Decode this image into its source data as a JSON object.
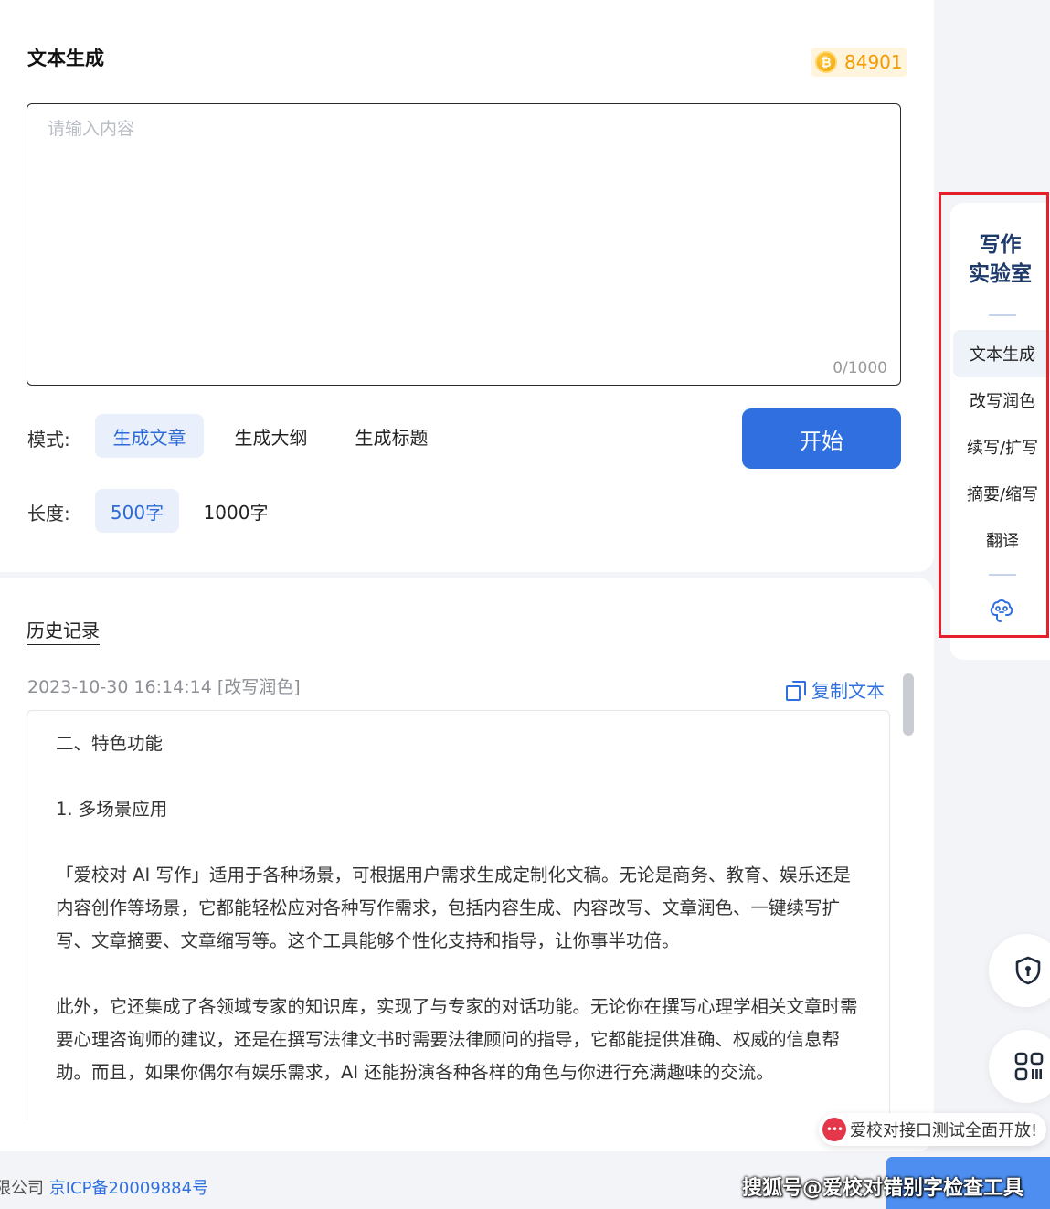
{
  "generator": {
    "title": "文本生成",
    "coins": "84901",
    "coin_symbol": "₿",
    "input_placeholder": "请输入内容",
    "input_value": "",
    "counter": "0/1000",
    "mode_label": "模式:",
    "modes": [
      {
        "label": "生成文章",
        "active": true
      },
      {
        "label": "生成大纲",
        "active": false
      },
      {
        "label": "生成标题",
        "active": false
      }
    ],
    "length_label": "长度:",
    "lengths": [
      {
        "label": "500字",
        "active": true
      },
      {
        "label": "1000字",
        "active": false
      }
    ],
    "start_label": "开始"
  },
  "history": {
    "title": "历史记录",
    "entry_time": "2023-10-30 16:14:14 [改写润色]",
    "copy_label": "复制文本",
    "paragraphs": [
      "二、特色功能",
      "1. 多场景应用",
      "「爱校对 AI 写作」适用于各种场景，可根据用户需求生成定制化文稿。无论是商务、教育、娱乐还是内容创作等场景，它都能轻松应对各种写作需求，包括内容生成、内容改写、文章润色、一键续写扩写、文章摘要、文章缩写等。这个工具能够个性化支持和指导，让你事半功倍。",
      "此外，它还集成了各领域专家的知识库，实现了与专家的对话功能。无论你在撰写心理学相关文章时需要心理咨询师的建议，还是在撰写法律文书时需要法律顾问的指导，它都能提供准确、权威的信息帮助。而且，如果你偶尔有娱乐需求，AI 还能扮演各种各样的角色与你进行充满趣味的交流。"
    ]
  },
  "sidebar": {
    "title_line1": "写作",
    "title_line2": "实验室",
    "items": [
      {
        "label": "文本生成",
        "active": true
      },
      {
        "label": "改写润色",
        "active": false
      },
      {
        "label": "续写/扩写",
        "active": false
      },
      {
        "label": "摘要/缩写",
        "active": false
      },
      {
        "label": "翻译",
        "active": false
      }
    ]
  },
  "toast": {
    "icon_text": "•••",
    "text": "爱校对接口测试全面开放!"
  },
  "footer": {
    "company_fragment": "限公司",
    "icp": "京ICP备20009884号",
    "watermark": "搜狐号@爱校对错别字检查工具"
  },
  "colors": {
    "accent": "#2f6fe0",
    "coin": "#f29a00",
    "highlight_border": "#e6202a"
  }
}
